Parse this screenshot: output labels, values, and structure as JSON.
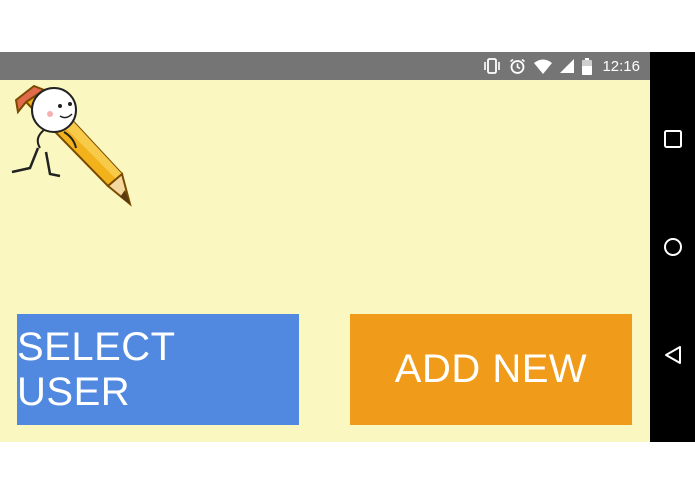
{
  "status_bar": {
    "time": "12:16",
    "icons": [
      "vibrate-icon",
      "alarm-icon",
      "wifi-icon",
      "signal-icon",
      "battery-icon"
    ]
  },
  "app": {
    "mascot": "pencil-character-icon",
    "buttons": {
      "select_user": "SELECT USER",
      "add_new": "ADD NEW"
    }
  },
  "nav_bar": {
    "items": [
      "recents-icon",
      "home-icon",
      "back-icon"
    ]
  },
  "colors": {
    "background": "#faf8c0",
    "status_bar": "#757575",
    "select_user_button": "#5289e0",
    "add_new_button": "#f09c1a",
    "nav_bar": "#000000"
  }
}
